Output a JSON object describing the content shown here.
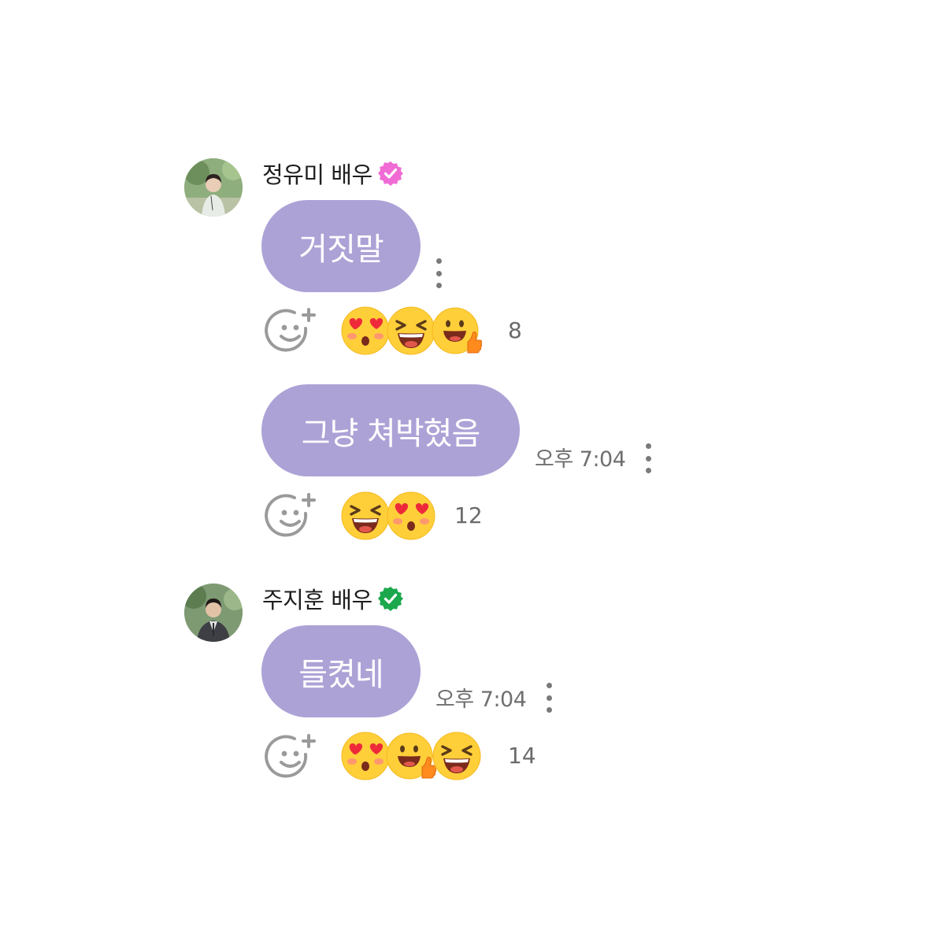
{
  "messages": [
    {
      "sender": "정유미 배우",
      "badge_color": "#f06bd4",
      "bubbles": [
        {
          "text": "거짓말",
          "time": "",
          "reactions": [
            "heart-eyes",
            "grinning-squint",
            "thumbs-up"
          ],
          "reaction_count": "8"
        },
        {
          "text": "그냥 쳐박혔음",
          "time": "오후 7:04",
          "reactions": [
            "grinning-squint",
            "heart-eyes"
          ],
          "reaction_count": "12"
        }
      ]
    },
    {
      "sender": "주지훈 배우",
      "badge_color": "#1ba84c",
      "bubbles": [
        {
          "text": "들켰네",
          "time": "오후 7:04",
          "reactions": [
            "heart-eyes",
            "thumbs-up",
            "grinning-squint"
          ],
          "reaction_count": "14"
        }
      ]
    }
  ],
  "colors": {
    "bubble": "#ada2d6",
    "bubble_text": "#ffffff",
    "muted_text": "#6f6f6f"
  }
}
